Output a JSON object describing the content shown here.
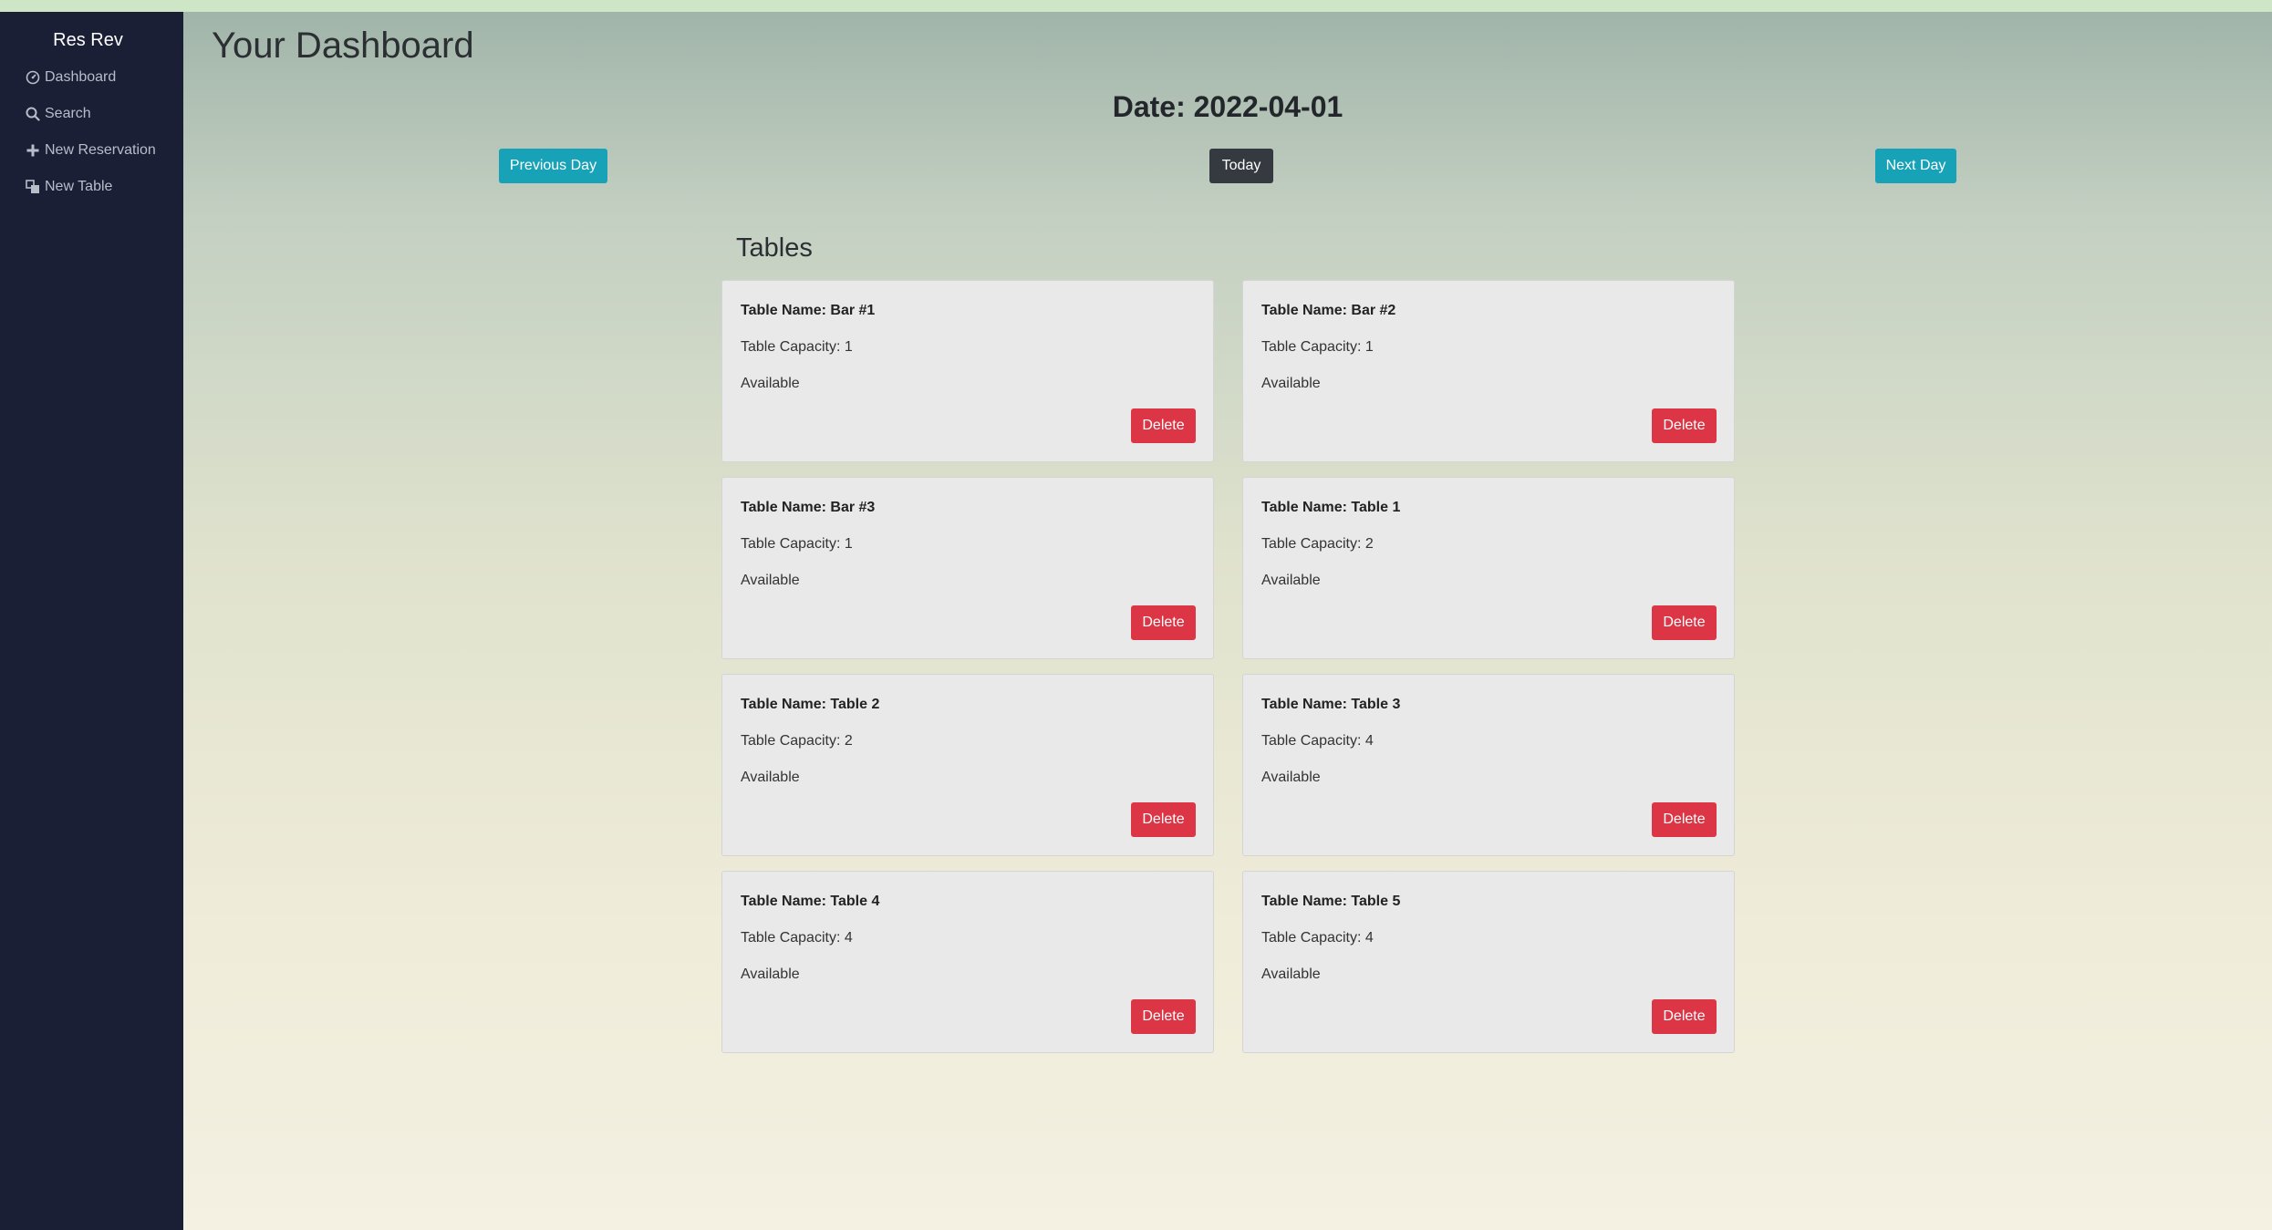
{
  "sidebar": {
    "brand": "Res Rev",
    "items": [
      {
        "label": "Dashboard",
        "icon": "dashboard-icon"
      },
      {
        "label": "Search",
        "icon": "search-icon"
      },
      {
        "label": "New Reservation",
        "icon": "plus-icon"
      },
      {
        "label": "New Table",
        "icon": "table-icon"
      }
    ]
  },
  "header": {
    "title": "Your Dashboard",
    "date": "Date: 2022-04-01"
  },
  "controls": {
    "previous": "Previous Day",
    "today": "Today",
    "next": "Next Day"
  },
  "tables_section": {
    "title": "Tables",
    "delete_label": "Delete",
    "cards": [
      {
        "name": "Table Name: Bar #1",
        "capacity": "Table Capacity: 1",
        "status": "Available"
      },
      {
        "name": "Table Name: Bar #2",
        "capacity": "Table Capacity: 1",
        "status": "Available"
      },
      {
        "name": "Table Name: Bar #3",
        "capacity": "Table Capacity: 1",
        "status": "Available"
      },
      {
        "name": "Table Name: Table 1",
        "capacity": "Table Capacity: 2",
        "status": "Available"
      },
      {
        "name": "Table Name: Table 2",
        "capacity": "Table Capacity: 2",
        "status": "Available"
      },
      {
        "name": "Table Name: Table 3",
        "capacity": "Table Capacity: 4",
        "status": "Available"
      },
      {
        "name": "Table Name: Table 4",
        "capacity": "Table Capacity: 4",
        "status": "Available"
      },
      {
        "name": "Table Name: Table 5",
        "capacity": "Table Capacity: 4",
        "status": "Available"
      }
    ]
  },
  "colors": {
    "sidebar_bg": "#1a1f36",
    "info": "#17a2b8",
    "dark": "#343a40",
    "danger": "#dc3545"
  }
}
